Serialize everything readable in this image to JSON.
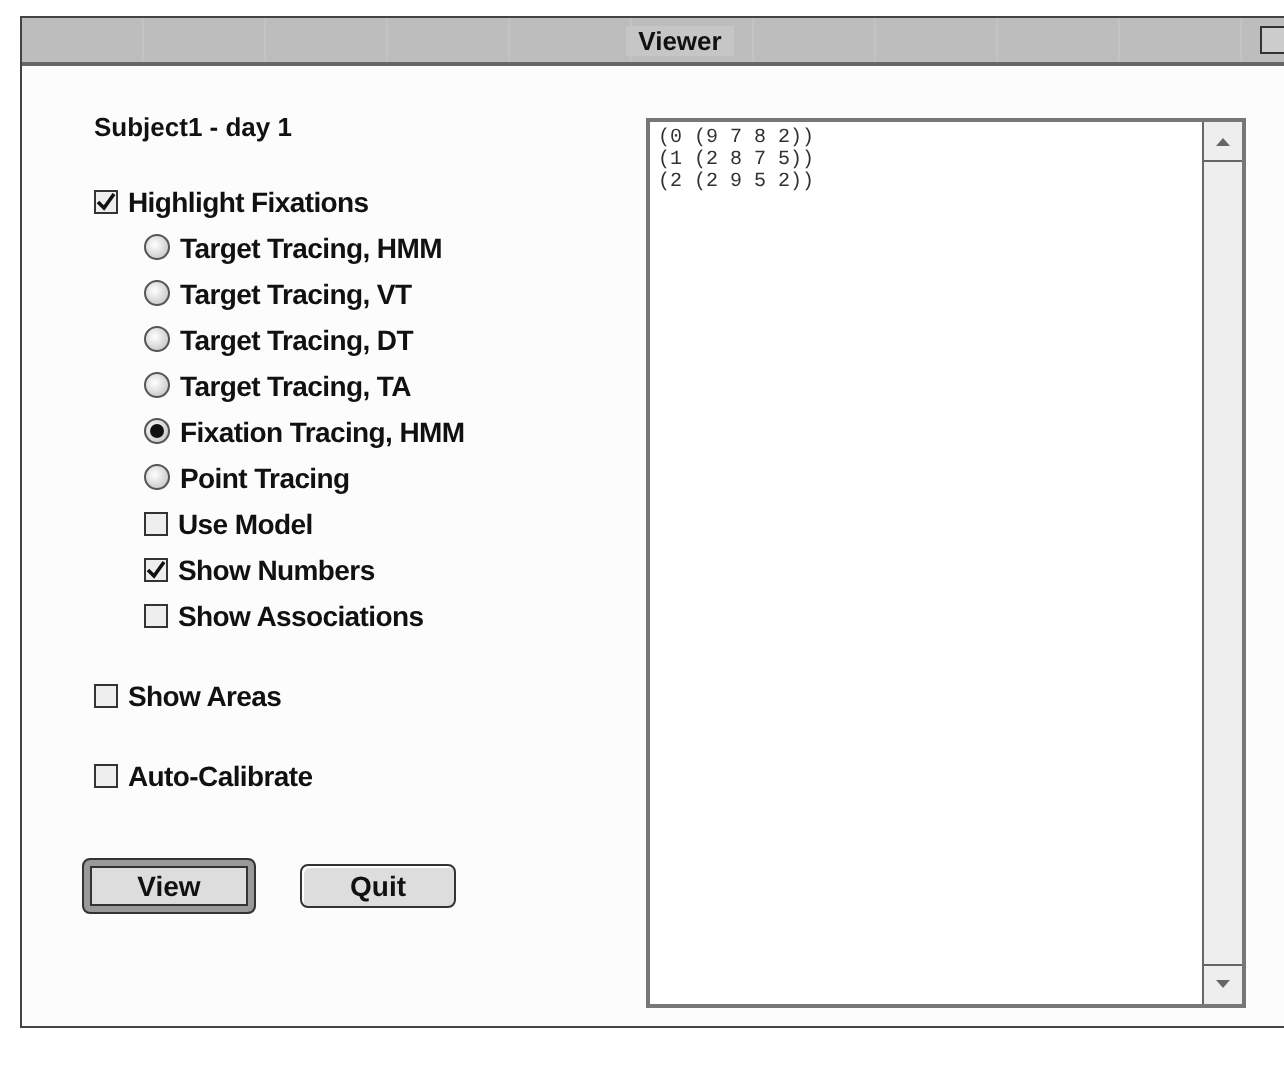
{
  "window": {
    "title": "Viewer"
  },
  "subject": "Subject1 - day 1",
  "options": [
    {
      "kind": "checkbox",
      "label": "Highlight Fixations",
      "checked": true,
      "children": [
        {
          "kind": "radio",
          "label": "Target Tracing, HMM",
          "selected": false
        },
        {
          "kind": "radio",
          "label": "Target Tracing, VT",
          "selected": false
        },
        {
          "kind": "radio",
          "label": "Target Tracing, DT",
          "selected": false
        },
        {
          "kind": "radio",
          "label": "Target Tracing, TA",
          "selected": false
        },
        {
          "kind": "radio",
          "label": "Fixation Tracing, HMM",
          "selected": true
        },
        {
          "kind": "radio",
          "label": "Point Tracing",
          "selected": false
        },
        {
          "kind": "checkbox",
          "label": "Use Model",
          "checked": false
        },
        {
          "kind": "checkbox",
          "label": "Show Numbers",
          "checked": true
        },
        {
          "kind": "checkbox",
          "label": "Show Associations",
          "checked": false
        }
      ]
    },
    {
      "kind": "checkbox",
      "label": "Show Areas",
      "checked": false
    },
    {
      "kind": "checkbox",
      "label": "Auto-Calibrate",
      "checked": false
    }
  ],
  "buttons": [
    {
      "label": "View",
      "default": true
    },
    {
      "label": "Quit",
      "default": false
    }
  ],
  "output_lines": [
    "(0 (9 7 8 2))",
    "(1 (2 8 7 5))",
    "(2 (2 9 5 2))"
  ]
}
